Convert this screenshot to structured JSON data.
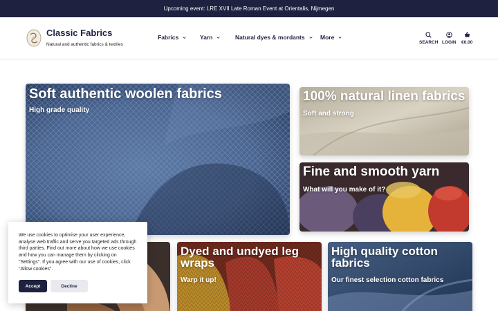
{
  "announcement": "Upcoming event: LRE XVII Late Roman Event at Orientalis, Nijmegen",
  "brand": {
    "title": "Classic Fabrics",
    "tagline": "Natural and authentic fabrics & textiles"
  },
  "nav": [
    {
      "label": "Fabrics"
    },
    {
      "label": "Yarn"
    },
    {
      "label": "Natural dyes & mordants"
    },
    {
      "label": "More"
    }
  ],
  "utilities": {
    "search": "SEARCH",
    "login": "LOGIN",
    "cart": "€0.00"
  },
  "tiles": {
    "wool": {
      "title": "Soft authentic woolen fabrics",
      "subtitle": "High grade quality"
    },
    "linen": {
      "title": "100% natural linen fabrics",
      "subtitle": "Soft and strong"
    },
    "yarn": {
      "title": "Fine and smooth yarn",
      "subtitle": "What will you make of it?"
    },
    "legwraps": {
      "title": "Dyed and undyed leg wraps",
      "subtitle": "Warp it up!"
    },
    "cotton": {
      "title": "High quality cotton fabrics",
      "subtitle": "Our finest selection cotton fabrics"
    }
  },
  "cookie": {
    "text": "We use cookies to optimise your user experience, analyse web traffic and serve you targeted ads through third parties. Find out more about how we use cookies and how you can manage them by clicking on \"Settings\". If you agree with our use of cookies, click \"Allow cookies\".",
    "accept": "Accept",
    "decline": "Decline"
  },
  "colors": {
    "brand_navy": "#1e2140"
  }
}
